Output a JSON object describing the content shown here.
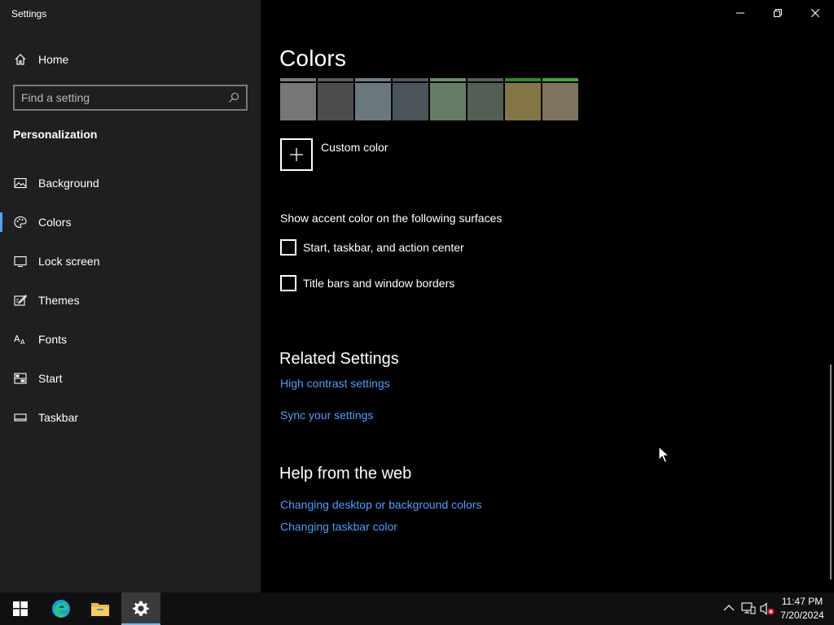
{
  "window": {
    "title": "Settings"
  },
  "sidebar": {
    "home_label": "Home",
    "search_placeholder": "Find a setting",
    "section_label": "Personalization",
    "items": [
      {
        "label": "Background",
        "icon": "picture-icon",
        "active": false
      },
      {
        "label": "Colors",
        "icon": "palette-icon",
        "active": true
      },
      {
        "label": "Lock screen",
        "icon": "lock-screen-icon",
        "active": false
      },
      {
        "label": "Themes",
        "icon": "brush-icon",
        "active": false
      },
      {
        "label": "Fonts",
        "icon": "fonts-icon",
        "active": false
      },
      {
        "label": "Start",
        "icon": "start-icon",
        "active": false
      },
      {
        "label": "Taskbar",
        "icon": "taskbar-icon",
        "active": false
      }
    ]
  },
  "main": {
    "title": "Colors",
    "swatches": [
      {
        "cap": "#7a7a7a",
        "fill": "#767676"
      },
      {
        "cap": "#5a5a5a",
        "fill": "#4c4c4c"
      },
      {
        "cap": "#6f7c8a",
        "fill": "#69797e"
      },
      {
        "cap": "#4e5662",
        "fill": "#4a5459"
      },
      {
        "cap": "#6c8c6c",
        "fill": "#647c64"
      },
      {
        "cap": "#516059",
        "fill": "#525e54"
      },
      {
        "cap": "#2e8b22",
        "fill": "#847545"
      },
      {
        "cap": "#3aa834",
        "fill": "#7e735f"
      }
    ],
    "custom_color_label": "Custom color",
    "accent_heading": "Show accent color on the following surfaces",
    "checkboxes": [
      {
        "label": "Start, taskbar, and action center",
        "checked": false
      },
      {
        "label": "Title bars and window borders",
        "checked": false
      }
    ],
    "related": {
      "heading": "Related Settings",
      "links": [
        "High contrast settings",
        "Sync your settings"
      ]
    },
    "help": {
      "heading": "Help from the web",
      "links": [
        "Changing desktop or background colors",
        "Changing taskbar color"
      ]
    }
  },
  "taskbar": {
    "pinned": [
      "windows-start-icon",
      "edge-icon",
      "file-explorer-icon",
      "settings-gear-icon"
    ],
    "tray": [
      "chevron-up-icon",
      "network-icon",
      "volume-muted-icon"
    ],
    "time": "11:47 PM",
    "date": "7/20/2024"
  },
  "colors": {
    "accent_link": "#4d9fff",
    "sidebar_bg": "#1f1f1f",
    "content_bg": "#000000"
  }
}
